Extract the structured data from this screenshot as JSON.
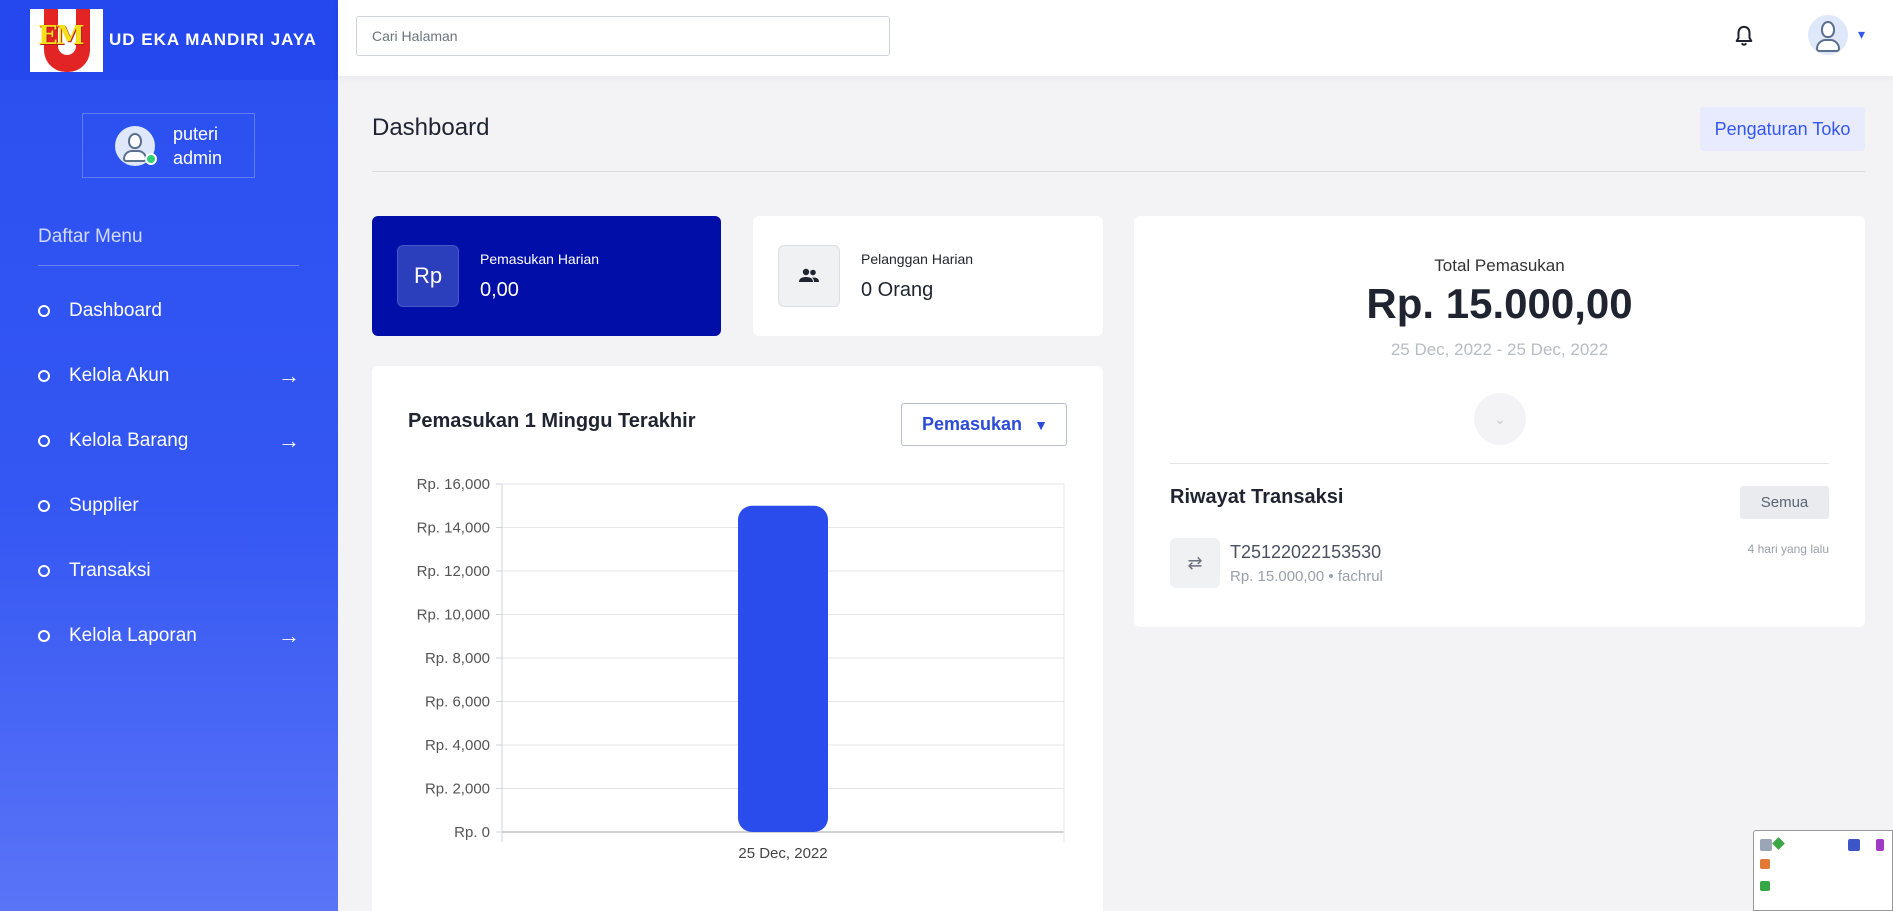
{
  "brand": {
    "name": "UD EKA MANDIRI JAYA",
    "logo_text": "EM"
  },
  "user": {
    "name": "puteri",
    "role": "admin"
  },
  "sidebar": {
    "menu_title": "Daftar Menu",
    "items": [
      {
        "label": "Dashboard",
        "has_arrow": false
      },
      {
        "label": "Kelola Akun",
        "has_arrow": true
      },
      {
        "label": "Kelola Barang",
        "has_arrow": true
      },
      {
        "label": "Supplier",
        "has_arrow": false
      },
      {
        "label": "Transaksi",
        "has_arrow": false
      },
      {
        "label": "Kelola Laporan",
        "has_arrow": true
      }
    ]
  },
  "topbar": {
    "search_placeholder": "Cari Halaman"
  },
  "page": {
    "title": "Dashboard",
    "settings_button": "Pengaturan Toko"
  },
  "stats": {
    "income": {
      "icon_text": "Rp",
      "label": "Pemasukan Harian",
      "value": "0,00"
    },
    "customers": {
      "label": "Pelanggan Harian",
      "value": "0 Orang"
    }
  },
  "chart_card": {
    "title": "Pemasukan 1 Minggu Terakhir",
    "select_value": "Pemasukan"
  },
  "chart_data": {
    "type": "bar",
    "categories": [
      "25 Dec, 2022"
    ],
    "values": [
      15000
    ],
    "ylim": [
      0,
      16000
    ],
    "yticks": [
      0,
      2000,
      4000,
      6000,
      8000,
      10000,
      12000,
      14000,
      16000
    ],
    "ytick_labels": [
      "Rp. 0",
      "Rp. 2,000",
      "Rp. 4,000",
      "Rp. 6,000",
      "Rp. 8,000",
      "Rp. 10,000",
      "Rp. 12,000",
      "Rp. 14,000",
      "Rp. 16,000"
    ],
    "bar_color": "#2b4ced",
    "grid": true
  },
  "summary": {
    "total_label": "Total Pemasukan",
    "total_value": "Rp. 15.000,00",
    "date_range": "25 Dec, 2022 - 25 Dec, 2022"
  },
  "history": {
    "title": "Riwayat Transaksi",
    "all_button": "Semua",
    "transactions": [
      {
        "id": "T25122022153530",
        "amount": "Rp. 15.000,00",
        "user": "fachrul",
        "time": "4 hari yang lalu"
      }
    ]
  },
  "colors": {
    "accent": "#3457f3",
    "income_card": "#020ea8"
  }
}
